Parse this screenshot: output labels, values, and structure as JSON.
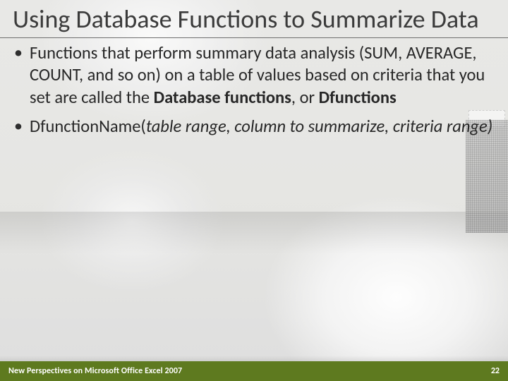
{
  "title": "Using Database Functions to Summarize Data",
  "bullets": [
    {
      "pre": "Functions that perform summary data analysis (SUM, AVERAGE, COUNT, and so on) on a table of values based on criteria that you set are called the ",
      "bold1": "Database functions",
      "mid": ", or ",
      "bold2": "Dfunctions",
      "post": ""
    },
    {
      "pre": "DfunctionName(",
      "ital": "table range, column to summarize, criteria range)",
      "post": ""
    }
  ],
  "footer": {
    "left": "New Perspectives on Microsoft Office Excel 2007",
    "page": "22"
  },
  "colors": {
    "footer_bg": "#5e7a1f"
  }
}
